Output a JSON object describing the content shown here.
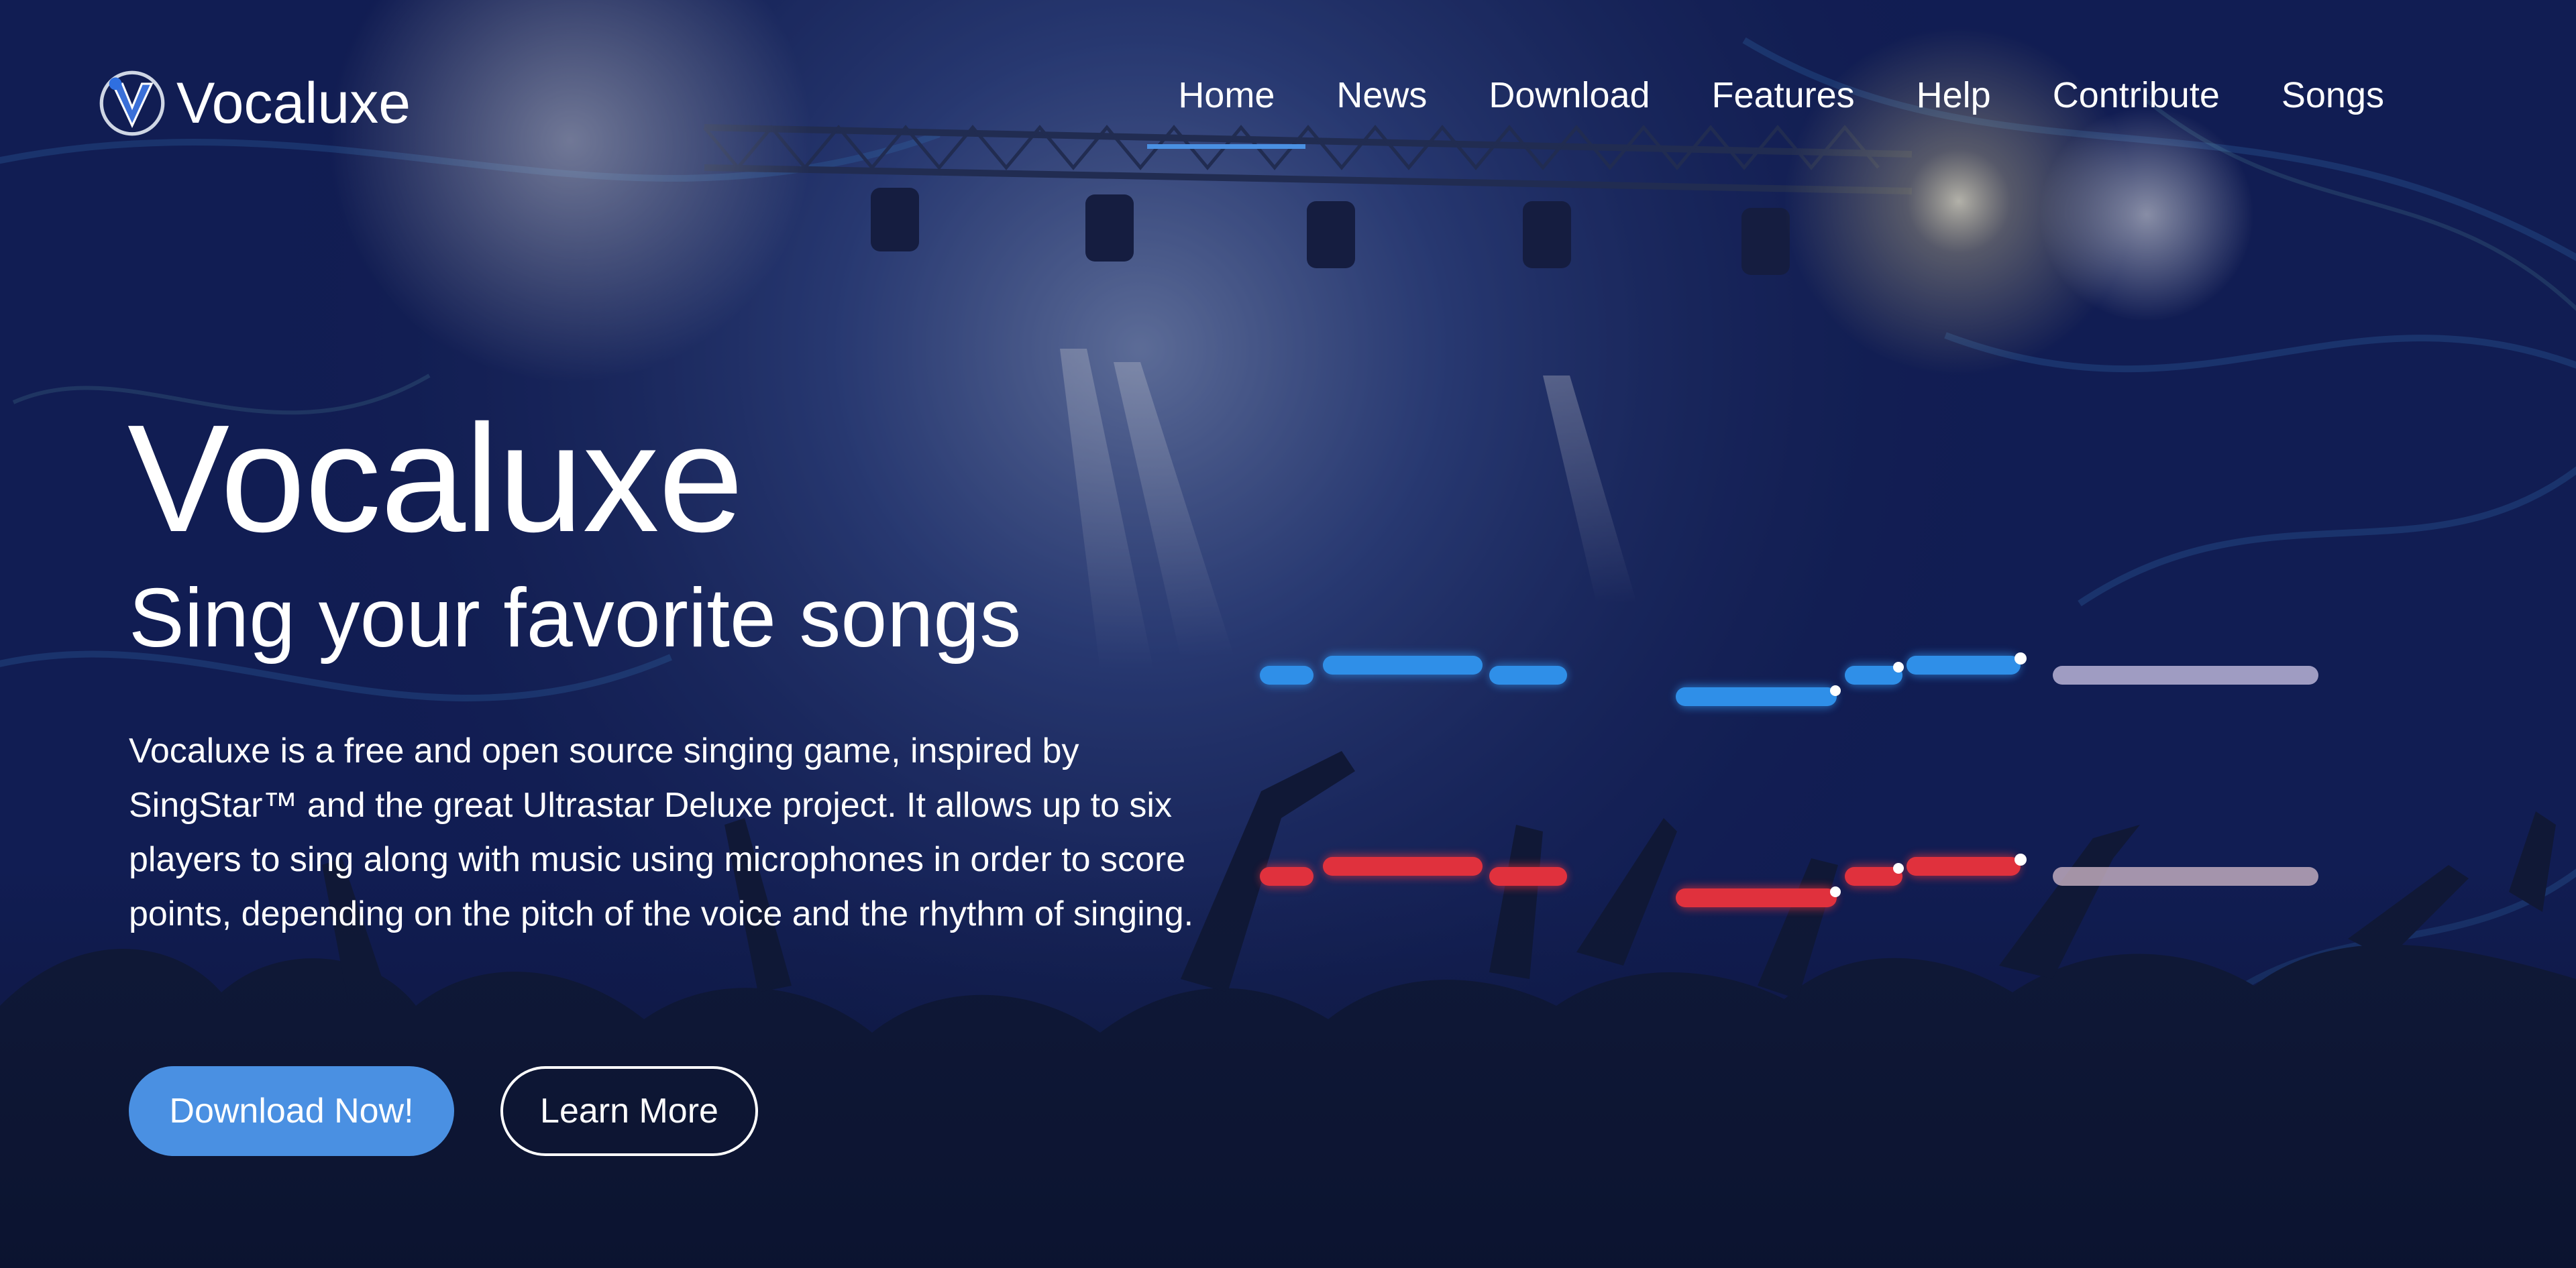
{
  "brand": {
    "name": "Vocaluxe",
    "logo_icon": "vocaluxe-v-logo-icon"
  },
  "nav": {
    "active": "Home",
    "items": [
      "Home",
      "News",
      "Download",
      "Features",
      "Help",
      "Contribute",
      "Songs"
    ]
  },
  "hero": {
    "title": "Vocaluxe",
    "subtitle": "Sing your favorite songs",
    "description": "Vocaluxe is a free and open source singing game, inspired by SingStar™ and the great Ultrastar Deluxe project. It allows up to six players to sing along with music using microphones in order to score points, depending on the pitch of the voice and the rhythm of singing.",
    "primary_button": "Download Now!",
    "secondary_button": "Learn More"
  },
  "colors": {
    "accent": "#4a90e2",
    "note_blue": "#2f8fe8",
    "note_red": "#e0313d",
    "note_inactive": "#b8b3d6",
    "background": "#0d1530"
  },
  "decor": {
    "background_image": "concert-crowd-stage-lights",
    "pitch_lines": [
      "player-1-blue-notes",
      "player-2-red-notes"
    ]
  }
}
